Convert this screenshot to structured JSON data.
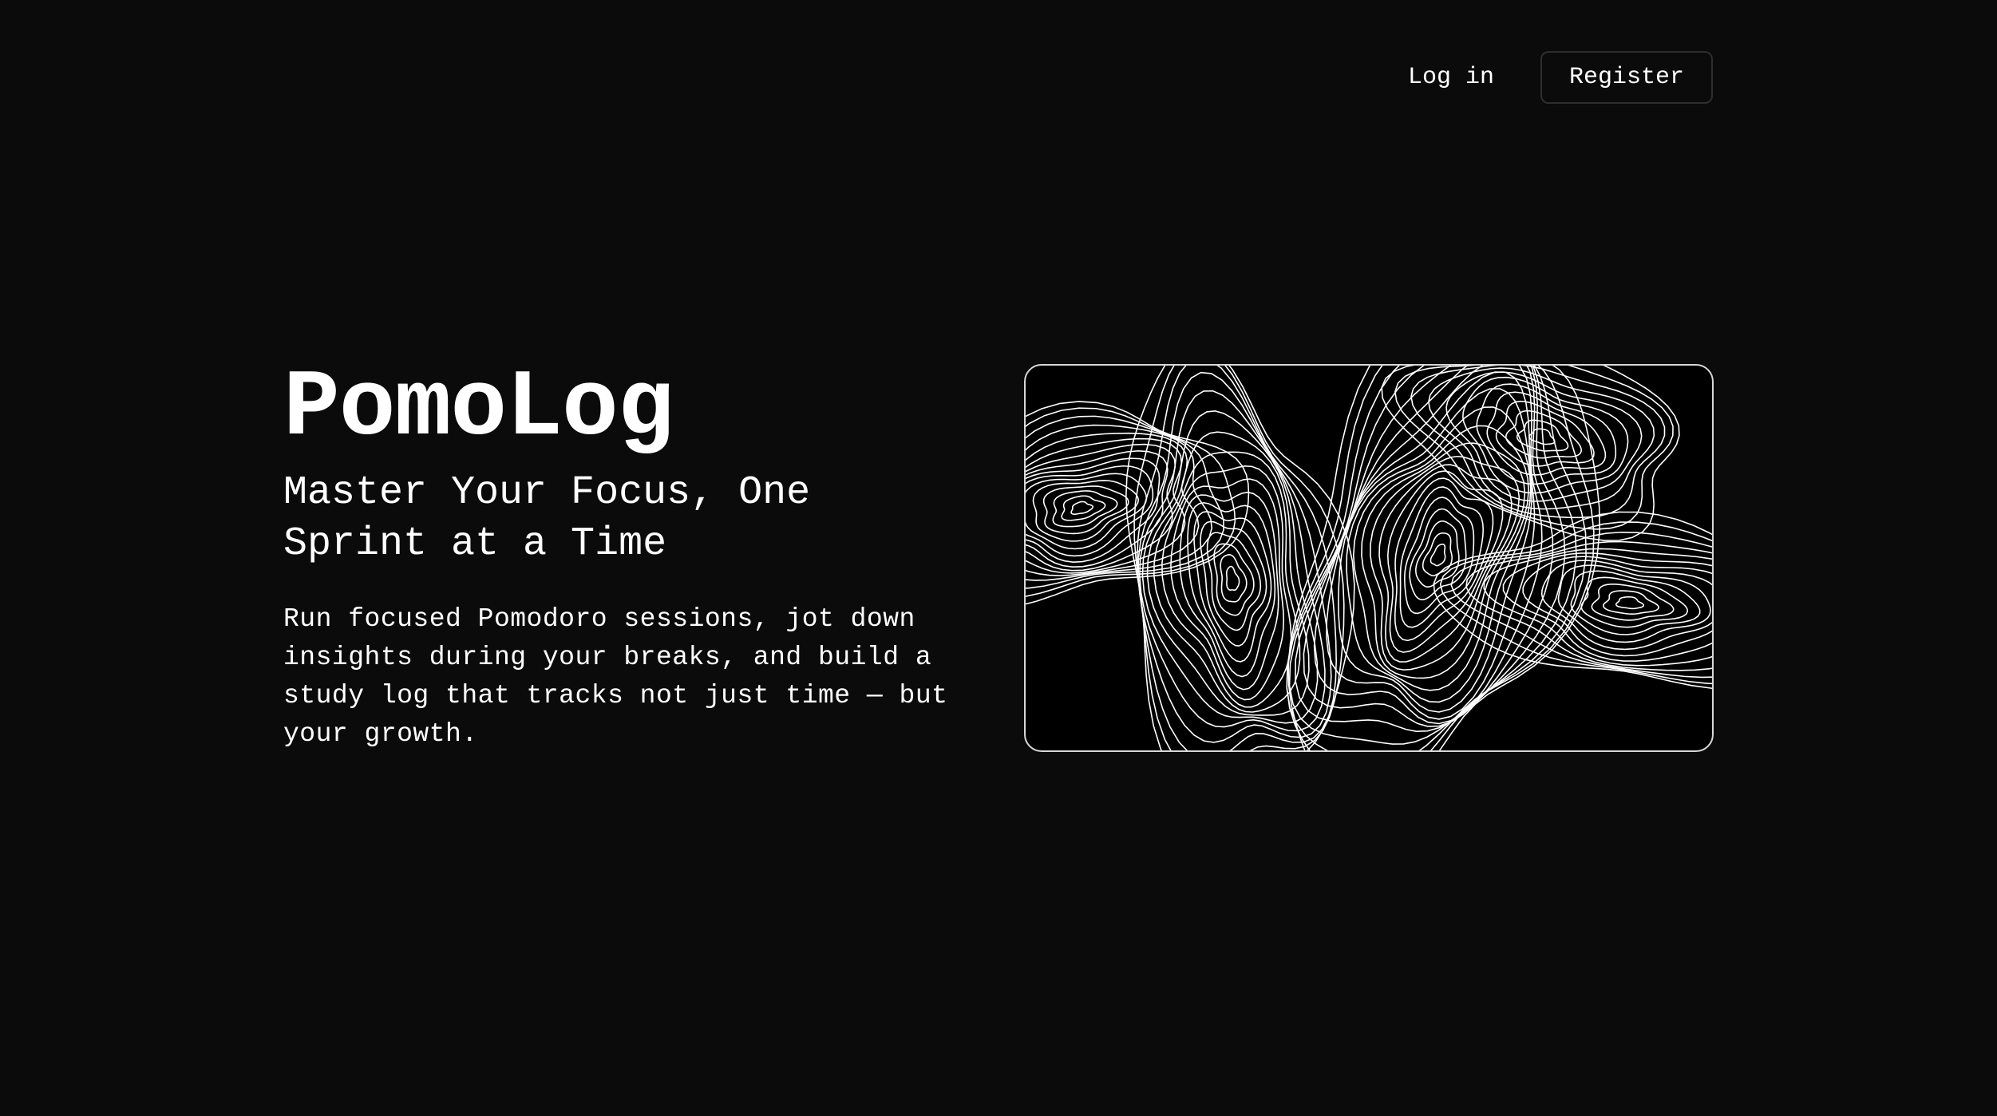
{
  "nav": {
    "login_label": "Log in",
    "register_label": "Register"
  },
  "hero": {
    "title": "PomoLog",
    "tagline": "Master Your Focus, One Sprint at a Time",
    "description": "Run focused Pomodoro sessions, jot down insights during your breaks, and build a study log that tracks not just time — but your growth."
  },
  "colors": {
    "background": "#0b0b0b",
    "text": "#ffffff",
    "button_border": "#2e2e2e",
    "contour_lines": "#ffffff"
  }
}
